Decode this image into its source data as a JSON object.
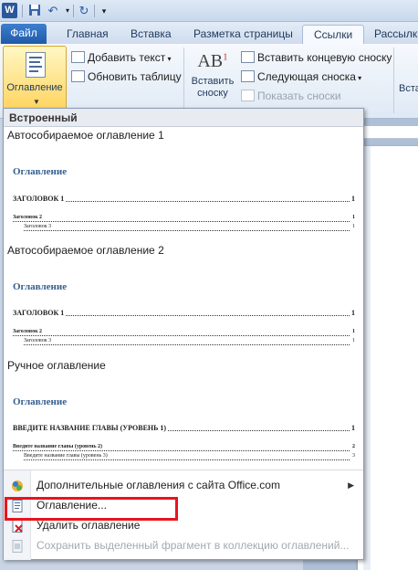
{
  "quick_access": {
    "app_icon_label": "W"
  },
  "tabs": [
    "Файл",
    "Главная",
    "Вставка",
    "Разметка страницы",
    "Ссылки",
    "Рассылки"
  ],
  "ribbon": {
    "toc_button_label": "Оглавление",
    "add_text_label": "Добавить текст",
    "update_table_label": "Обновить таблицу",
    "insert_footnote_label": "Вставить\nсноску",
    "insert_footnote_line1": "Вставить",
    "insert_footnote_line2": "сноску",
    "insert_endnote_label": "Вставить концевую сноску",
    "next_footnote_label": "Следующая сноска",
    "show_notes_label": "Показать сноски",
    "right_cut_label": "Вста"
  },
  "gallery": {
    "header": "Встроенный",
    "items": [
      {
        "title": "Автособираемое оглавление 1",
        "toc_heading": "Оглавление",
        "lines": [
          {
            "text": "ЗАГОЛОВОК 1",
            "page": "1"
          },
          {
            "text": "Заголовок 2",
            "page": "1"
          },
          {
            "text": "Заголовок 3",
            "page": "1"
          }
        ]
      },
      {
        "title": "Автособираемое оглавление 2",
        "toc_heading": "Оглавление",
        "lines": [
          {
            "text": "ЗАГОЛОВОК 1",
            "page": "1"
          },
          {
            "text": "Заголовок 2",
            "page": "1"
          },
          {
            "text": "Заголовок 3",
            "page": "1"
          }
        ]
      },
      {
        "title": "Ручное оглавление",
        "toc_heading": "Оглавление",
        "lines": [
          {
            "text": "ВВЕДИТЕ НАЗВАНИЕ ГЛАВЫ (УРОВЕНЬ 1)",
            "page": "1"
          },
          {
            "text": "Введите название главы (уровень 2)",
            "page": "2"
          },
          {
            "text": "Введите название главы (уровень 3)",
            "page": "3"
          }
        ]
      }
    ]
  },
  "commands": {
    "more_online": "Дополнительные оглавления с сайта Office.com",
    "toc_dialog": "Оглавление...",
    "remove_toc": "Удалить оглавление",
    "save_selection": "Сохранить выделенный фрагмент в коллекцию оглавлений..."
  },
  "colors": {
    "highlight": "#e8141f",
    "toc_heading": "#365f91",
    "file_tab": "#2b5fa8"
  }
}
